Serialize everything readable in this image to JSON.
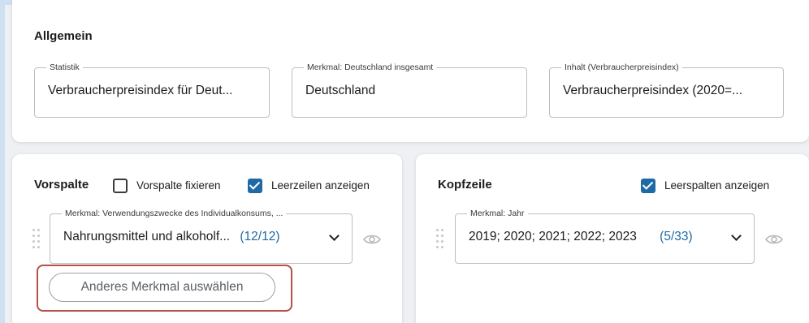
{
  "allgemein": {
    "title": "Allgemein",
    "fields": [
      {
        "legend": "Statistik",
        "value": "Verbraucherpreisindex für Deut..."
      },
      {
        "legend": "Merkmal: Deutschland insgesamt",
        "value": "Deutschland"
      },
      {
        "legend": "Inhalt (Verbraucherpreisindex)",
        "value": "Verbraucherpreisindex (2020=..."
      }
    ]
  },
  "vorspalte": {
    "title": "Vorspalte",
    "fix_label": "Vorspalte fixieren",
    "fix_checked": false,
    "empty_rows_label": "Leerzeilen anzeigen",
    "empty_rows_checked": true,
    "select": {
      "legend": "Merkmal: Verwendungszwecke des Individualkonsums, ...",
      "value": "Nahrungsmittel und alkoholf...",
      "count": "(12/12)"
    },
    "other_button": "Anderes Merkmal auswählen"
  },
  "kopfzeile": {
    "title": "Kopfzeile",
    "empty_cols_label": "Leerspalten anzeigen",
    "empty_cols_checked": true,
    "select": {
      "legend": "Merkmal: Jahr",
      "value": "2019; 2020; 2021; 2022; 2023",
      "count": "(5/33)"
    }
  },
  "colors": {
    "accent": "#1f6aa5",
    "highlight": "#b5504a"
  }
}
